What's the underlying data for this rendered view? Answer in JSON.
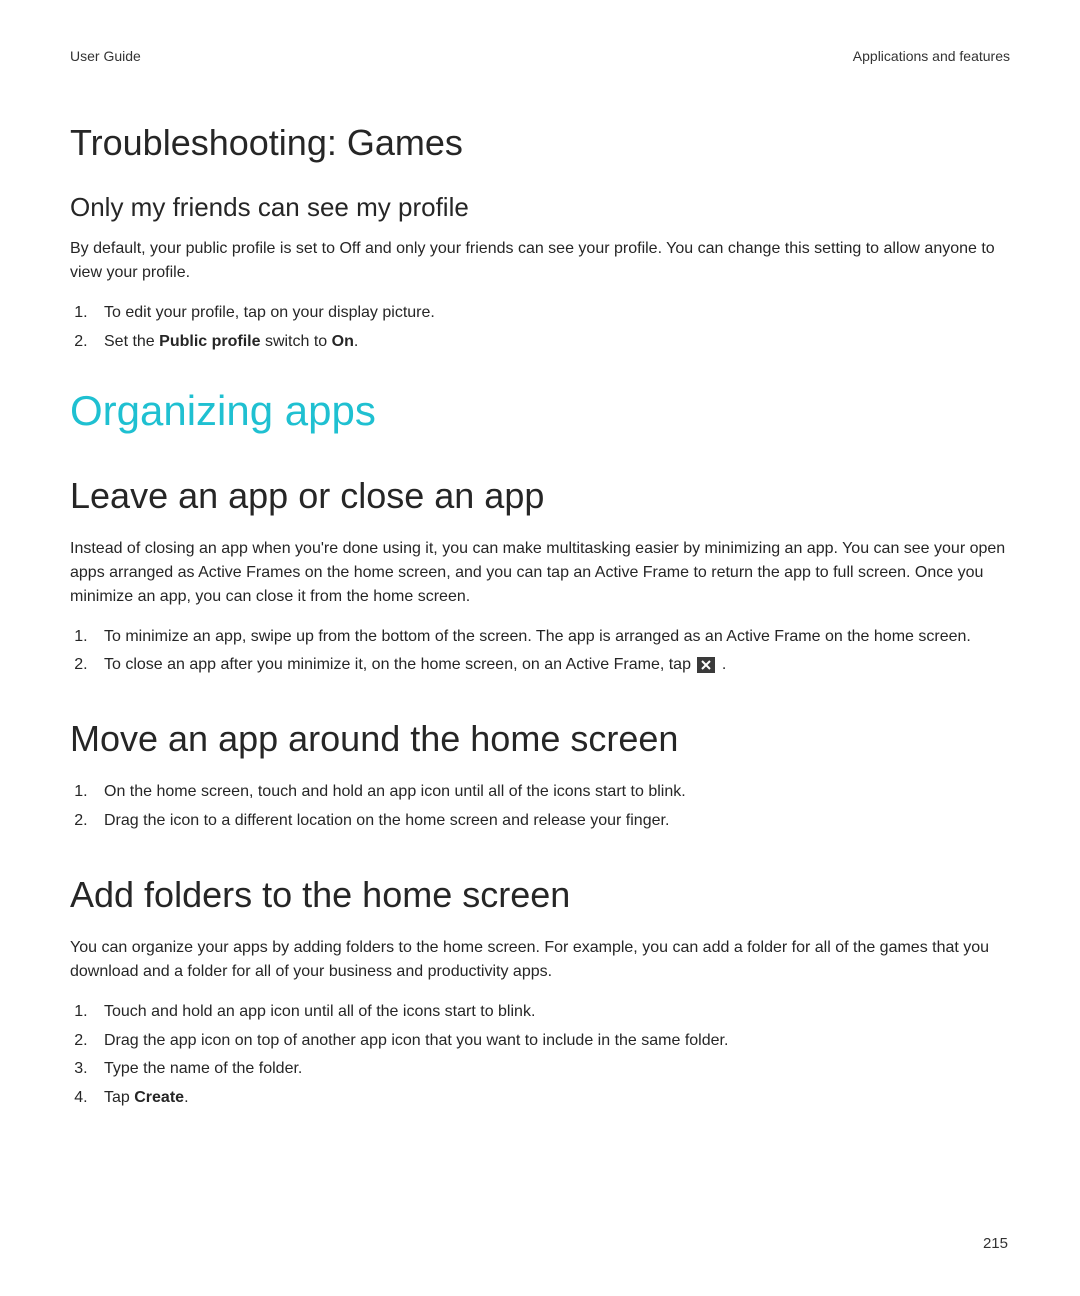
{
  "header": {
    "left": "User Guide",
    "right": "Applications and features"
  },
  "sec1": {
    "title": "Troubleshooting: Games",
    "sub1": "Only my friends can see my profile",
    "p1": "By default, your public profile is set to Off and only your friends can see your profile. You can change this setting to allow anyone to view your profile.",
    "li1": "To edit your profile, tap on your display picture.",
    "li2a": "Set the ",
    "li2b": "Public profile",
    "li2c": " switch to ",
    "li2d": "On",
    "li2e": "."
  },
  "chapter": "Organizing apps",
  "sec2": {
    "title": "Leave an app or close an app",
    "p1": "Instead of closing an app when you're done using it, you can make multitasking easier by minimizing an app. You can see your open apps arranged as Active Frames on the home screen, and you can tap an Active Frame to return the app to full screen. Once you minimize an app, you can close it from the home screen.",
    "li1": "To minimize an app, swipe up from the bottom of the screen. The app is arranged as an Active Frame on the home screen.",
    "li2a": "To close an app after you minimize it, on the home screen, on an Active Frame, tap ",
    "li2b": " ."
  },
  "sec3": {
    "title": "Move an app around the home screen",
    "li1": "On the home screen, touch and hold an app icon until all of the icons start to blink.",
    "li2": "Drag the icon to a different location on the home screen and release your finger."
  },
  "sec4": {
    "title": "Add folders to the home screen",
    "p1": "You can organize your apps by adding folders to the home screen. For example, you can add a folder for all of the games that you download and a folder for all of your business and productivity apps.",
    "li1": "Touch and hold an app icon until all of the icons start to blink.",
    "li2": "Drag the app icon on top of another app icon that you want to include in the same folder.",
    "li3": "Type the name of the folder.",
    "li4a": "Tap ",
    "li4b": "Create",
    "li4c": "."
  },
  "page_number": "215"
}
